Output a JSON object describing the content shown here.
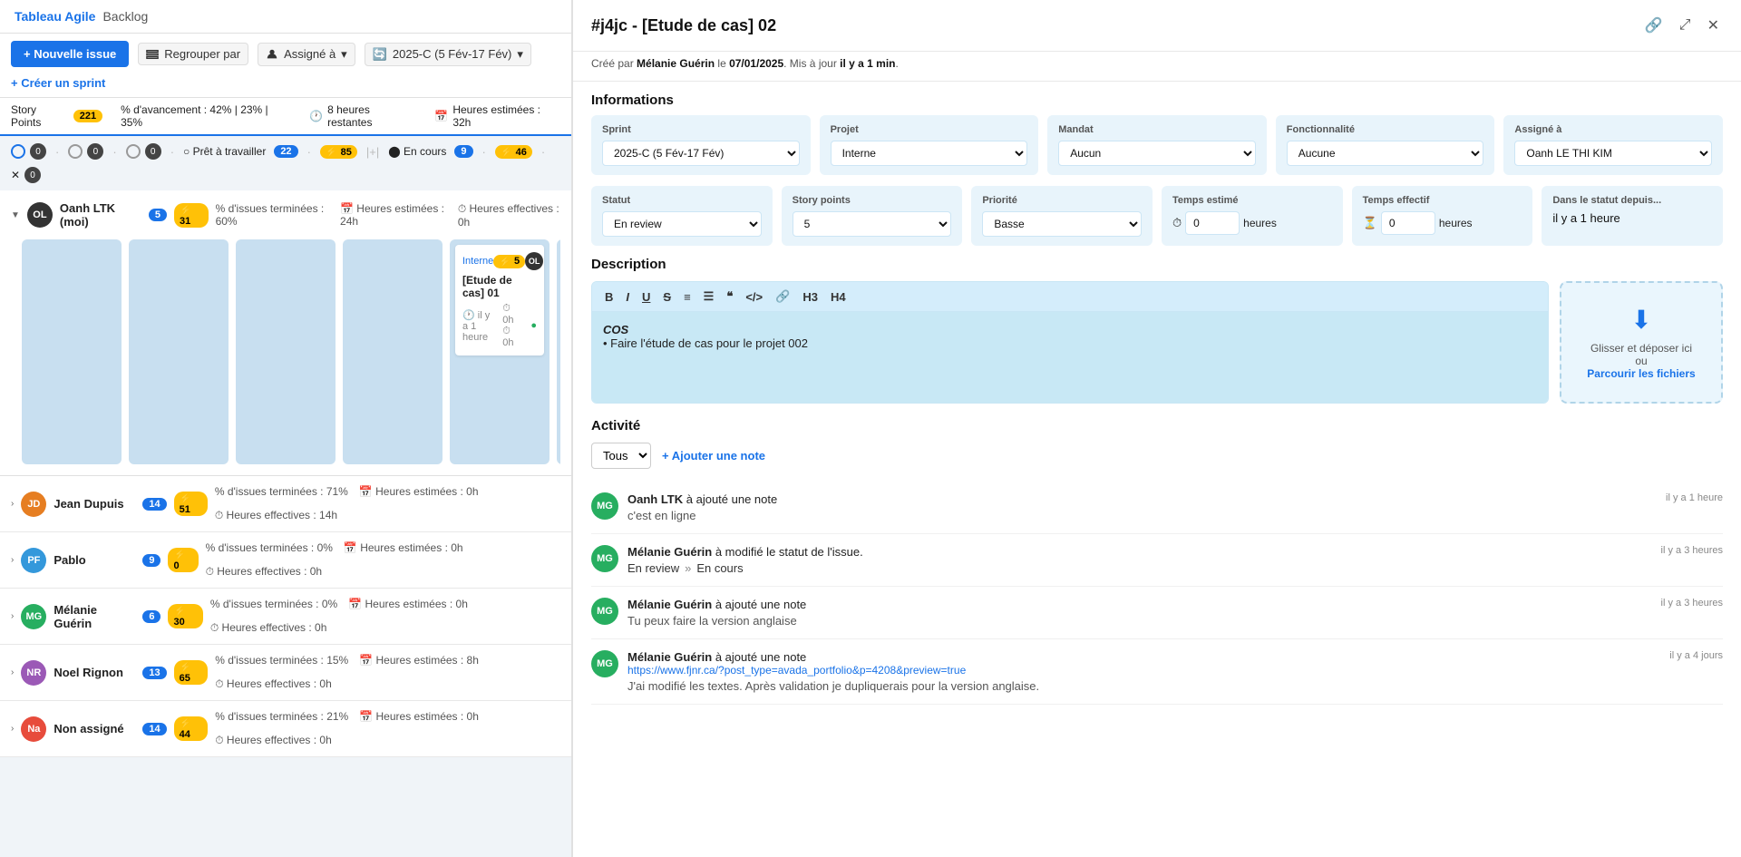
{
  "nav": {
    "app_name": "Tableau Agile",
    "separator": "|",
    "backlog": "Backlog"
  },
  "toolbar": {
    "new_issue": "+ Nouvelle issue",
    "group_by": "Regrouper par",
    "assigned_to": "Assigné à",
    "sprint": "2025-C (5 Fév-17 Fév)",
    "create_sprint": "+ Créer un sprint"
  },
  "stats_bar": {
    "story_points_label": "Story Points",
    "story_points_value": "221",
    "progress_label": "% d'avancement : 42% | 23% | 35%",
    "hours_remaining": "8 heures restantes",
    "hours_estimated": "Heures estimées : 32h"
  },
  "columns": [
    {
      "icon": "circle",
      "count": "0",
      "label": ""
    },
    {
      "icon": "circle",
      "count": "0",
      "label": ""
    },
    {
      "icon": "circle",
      "count": "0",
      "label": ""
    },
    {
      "label": "Prêt à travailler",
      "count": "22"
    },
    {
      "icon": "plus",
      "count": "85",
      "label": ""
    },
    {
      "label": "En cours",
      "count": "9"
    },
    {
      "icon": "plus",
      "count": "46",
      "label": ""
    },
    {
      "icon": "x",
      "count": "0",
      "label": ""
    }
  ],
  "users": [
    {
      "initials": "OL",
      "name": "Oanh LTK (moi)",
      "num_issues": "5",
      "story_points": "31",
      "progress": "% d'issues terminées : 60%",
      "estimated": "Heures estimées : 24h",
      "effective": "Heures effectives : 0h",
      "av_class": "av-ol"
    },
    {
      "initials": "JD",
      "name": "Jean Dupuis",
      "num_issues": "14",
      "story_points": "51",
      "progress": "% d'issues terminées : 71%",
      "estimated": "Heures estimées : 0h",
      "effective": "Heures effectives : 14h",
      "av_class": "av-jp"
    },
    {
      "initials": "PF",
      "name": "Pablo",
      "num_issues": "9",
      "story_points": "0",
      "progress": "% d'issues terminées : 0%",
      "estimated": "Heures estimées : 0h",
      "effective": "Heures effectives : 0h",
      "av_class": "av-pf"
    },
    {
      "initials": "MG",
      "name": "Mélanie Guérin",
      "num_issues": "6",
      "story_points": "30",
      "progress": "% d'issues terminées : 0%",
      "estimated": "Heures estimées : 0h",
      "effective": "Heures effectives : 0h",
      "av_class": "av-mg"
    },
    {
      "initials": "NR",
      "name": "Noel Rignon",
      "num_issues": "13",
      "story_points": "65",
      "progress": "% d'issues terminées : 15%",
      "estimated": "Heures estimées : 8h",
      "effective": "Heures effectives : 0h",
      "av_class": "av-nr"
    },
    {
      "initials": "Na",
      "name": "Non assigné",
      "num_issues": "14",
      "story_points": "44",
      "progress": "% d'issues terminées : 21%",
      "estimated": "Heures estimées : 0h",
      "effective": "Heures effectives : 0h",
      "av_class": "av-na"
    }
  ],
  "kanban_card": {
    "project": "Interne",
    "sp_badge": "5",
    "title": "[Etude de cas] 01",
    "time": "il y a 1 heure",
    "hours": "0h",
    "sub_hours": "0h"
  },
  "panel": {
    "title": "#j4jc - [Etude de cas] 02",
    "meta": "Créé par Mélanie Guérin le 07/01/2025. Mis à jour il y a 1 min.",
    "info_title": "Informations",
    "sprint_label": "Sprint",
    "sprint_value": "2025-C (5 Fév-17 Fév)",
    "project_label": "Projet",
    "project_value": "Interne",
    "mandate_label": "Mandat",
    "mandate_value": "Aucun",
    "function_label": "Fonctionnalité",
    "function_value": "Aucune",
    "assigned_label": "Assigné à",
    "assigned_value": "Oanh LE THI KIM",
    "status_label": "Statut",
    "status_value": "En review",
    "sp_label": "Story points",
    "sp_value": "5",
    "priority_label": "Priorité",
    "priority_value": "Basse",
    "time_est_label": "Temps estimé",
    "time_est_value": "0",
    "time_est_unit": "heures",
    "time_eff_label": "Temps effectif",
    "time_eff_value": "0",
    "time_eff_unit": "heures",
    "since_label": "Dans le statut depuis...",
    "since_value": "il y a 1 heure",
    "desc_title": "Description",
    "desc_content_italic": "COS",
    "desc_content_bullet": "• Faire l'étude de cas pour le projet 002",
    "upload_text1": "Glisser et déposer ici",
    "upload_text2": "ou",
    "upload_link": "Parcourir les fichiers",
    "activity_title": "Activité",
    "activity_filter": "Tous",
    "add_note_label": "+ Ajouter une note",
    "activities": [
      {
        "initials": "MG",
        "author": "Oanh LTK",
        "action": " à ajouté une note",
        "time": "il y a 1 heure",
        "body": "c'est en ligne"
      },
      {
        "initials": "MG",
        "author": "Mélanie Guérin",
        "action": " à modifié le statut de l'issue.",
        "time": "il y a 3 heures",
        "status_from": "En review",
        "status_to": "En cours"
      },
      {
        "initials": "MG",
        "author": "Mélanie Guérin",
        "action": " à ajouté une note",
        "time": "il y a 3 heures",
        "body": "Tu peux faire la version anglaise"
      },
      {
        "initials": "MG",
        "author": "Mélanie Guérin",
        "action": " à ajouté une note",
        "time": "il y a 4 jours",
        "body": "https://www.fjnr.ca/?post_type=avada_portfolio&p=4208&preview=true",
        "body2": "J'ai modifié les textes. Après validation je dupliquerais pour la version anglaise."
      }
    ]
  }
}
